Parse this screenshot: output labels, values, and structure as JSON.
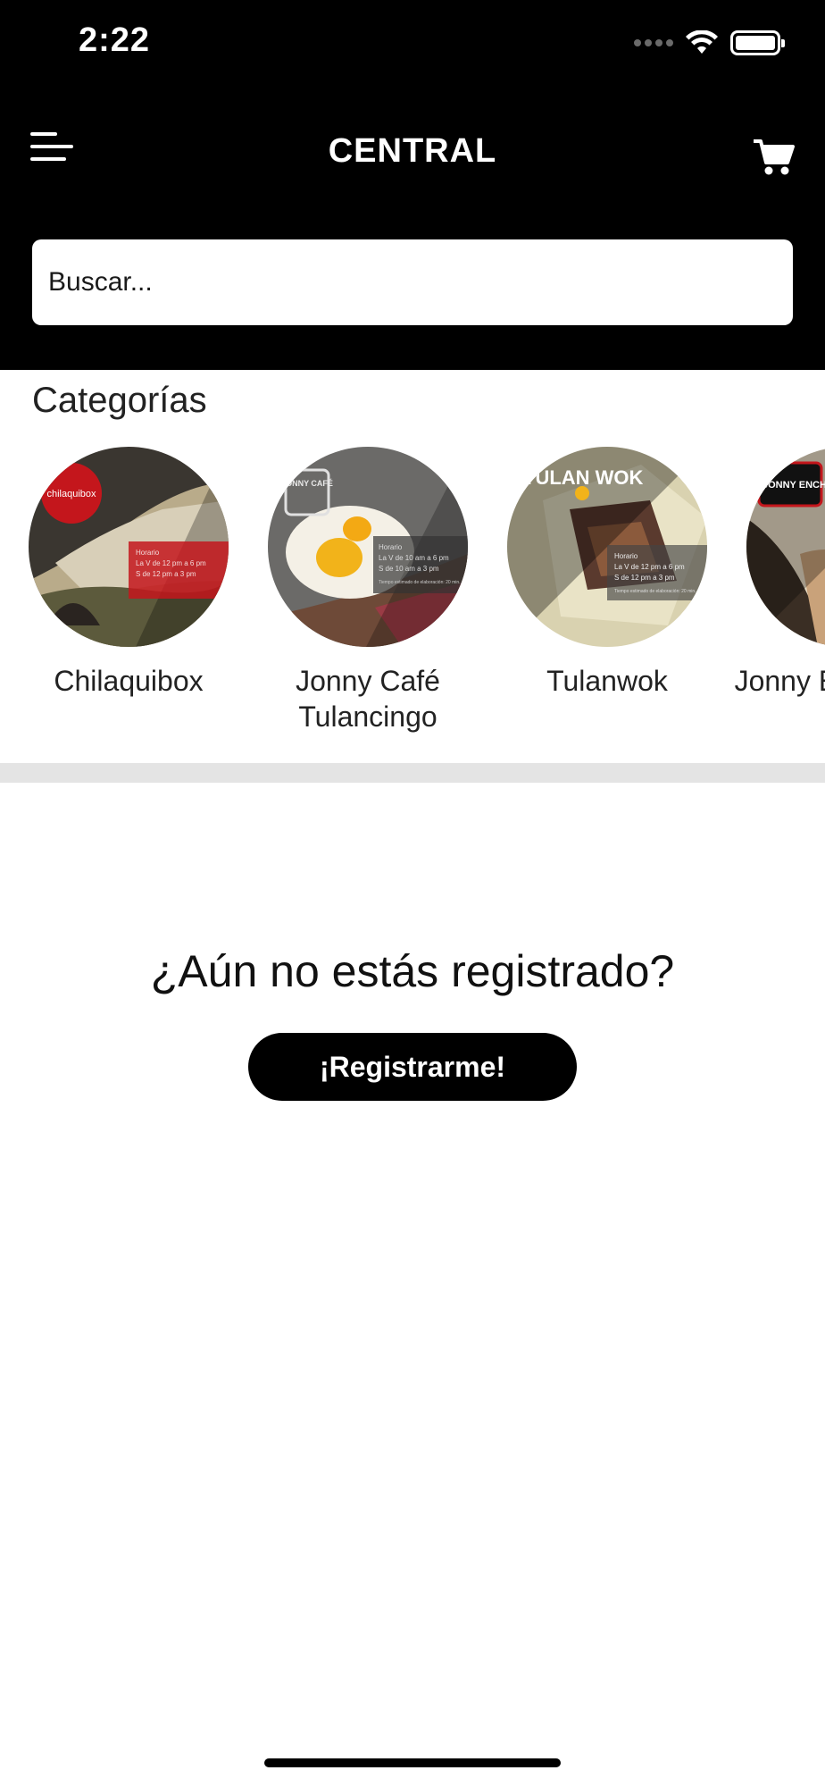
{
  "status_bar": {
    "time": "2:22",
    "icons": [
      "signal-icon",
      "wifi-icon",
      "battery-icon"
    ]
  },
  "header": {
    "title": "CENTRAL",
    "menu_icon": "hamburger-menu-icon",
    "cart_icon": "shopping-cart-icon"
  },
  "search": {
    "placeholder": "Buscar..."
  },
  "categories": {
    "title": "Categorías",
    "items": [
      {
        "name": "Chilaquibox",
        "logo_text": "chilaquibox",
        "hours_label": "Horario",
        "hours_1": "La V de 12 pm a 6 pm",
        "hours_2": "S de 12 pm a 3 pm"
      },
      {
        "name": "Jonny Café Tulancingo",
        "logo_text": "JONNY CAFÉ",
        "hours_label": "Horario",
        "hours_1": "La V de 10 am a 6 pm",
        "hours_2": "S de 10 am a 3 pm",
        "prep": "Tiempo estimado de elaboración: 20 min."
      },
      {
        "name": "Tulanwok",
        "logo_text": "TULAN WOK",
        "hours_label": "Horario",
        "hours_1": "La V de 12 pm a 6 pm",
        "hours_2": "S de 12 pm a 3 pm",
        "prep": "Tiempo estimado de elaboración: 20 min."
      },
      {
        "name": "Jonny Enchiladas",
        "logo_text": "JONNY ENCHILADAS"
      }
    ]
  },
  "register": {
    "question": "¿Aún no estás registrado?",
    "button_label": "¡Registrarme!"
  },
  "colors": {
    "header_bg": "#000000",
    "accent_red": "#c4161c",
    "divider": "#e4e4e4"
  }
}
